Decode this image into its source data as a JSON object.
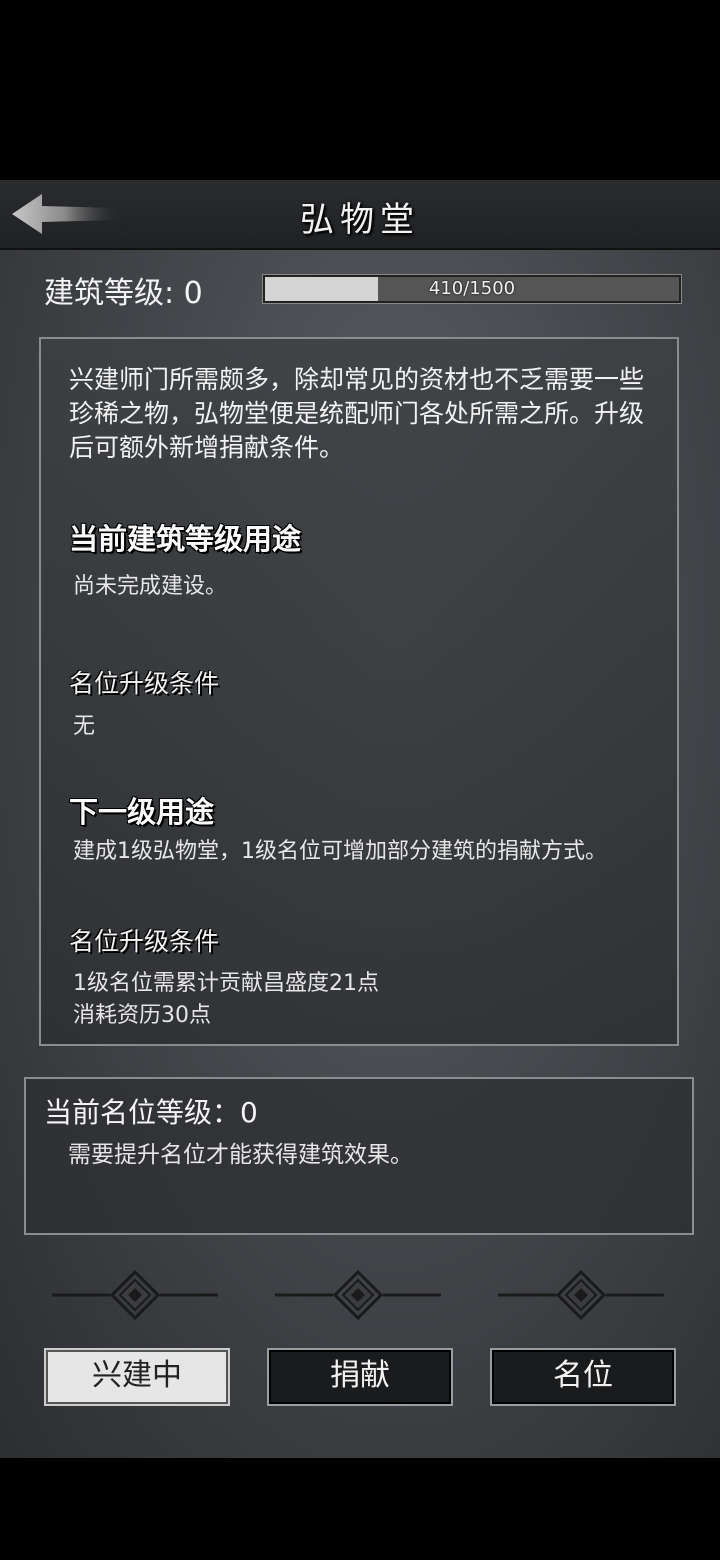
{
  "header": {
    "title": "弘物堂"
  },
  "building": {
    "level_label": "建筑等级: 0",
    "progress_text": "410/1500",
    "progress_fraction": 0.2733
  },
  "info": {
    "description": "兴建师门所需颇多，除却常见的资材也不乏需要一些珍稀之物，弘物堂便是统配师门各处所需之所。升级后可额外新增捐献条件。",
    "current_heading": "当前建筑等级用途",
    "current_text": "尚未完成建设。",
    "current_cond_heading": "名位升级条件",
    "current_cond_text": "无",
    "next_heading": "下一级用途",
    "next_text": "建成1级弘物堂，1级名位可增加部分建筑的捐献方式。",
    "next_cond_heading": "名位升级条件",
    "next_cond_lines": [
      "1级名位需累计贡献昌盛度21点",
      "消耗资历30点"
    ]
  },
  "status": {
    "rank_label": "当前名位等级：0",
    "rank_hint": "需要提升名位才能获得建筑效果。"
  },
  "tabs": [
    {
      "label": "兴建中",
      "active": true
    },
    {
      "label": "捐献",
      "active": false
    },
    {
      "label": "名位",
      "active": false
    }
  ],
  "icons": {
    "back": "back-arrow-icon",
    "ornament": "diamond-ornament-icon"
  }
}
